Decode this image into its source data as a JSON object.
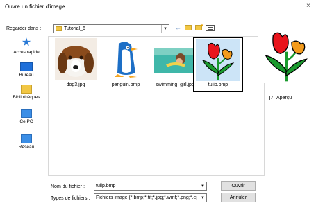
{
  "window": {
    "title": "Ouvre un fichier d'image",
    "close": "×"
  },
  "look_in": {
    "label": "Regarder dans :",
    "value": "Tutorial_6"
  },
  "sidebar": {
    "items": [
      {
        "label": "Accès rapide",
        "icon": "star-icon"
      },
      {
        "label": "Bureau",
        "icon": "desktop-icon"
      },
      {
        "label": "Bibliothèques",
        "icon": "folder-icon"
      },
      {
        "label": "Ce PC",
        "icon": "computer-icon"
      },
      {
        "label": "Réseau",
        "icon": "network-icon"
      }
    ]
  },
  "files": [
    {
      "name": "dog3.jpg",
      "selected": false
    },
    {
      "name": "penguin.bmp",
      "selected": false
    },
    {
      "name": "swimming_girl.jpg",
      "selected": false
    },
    {
      "name": "tulip.bmp",
      "selected": true
    }
  ],
  "filename": {
    "label": "Nom du fichier :",
    "value": "tulip.bmp"
  },
  "filetype": {
    "label": "Types de fichiers :",
    "value": "Fichiers image (*.bmp;*.tif;*.jpg;*.wmf;*.png;*.ep"
  },
  "buttons": {
    "open": "Ouvrir",
    "cancel": "Annuler"
  },
  "preview": {
    "label": "Aperçu",
    "checked": true,
    "checkmark": "✓"
  },
  "colors": {
    "selection_border": "#000000",
    "tulip_red": "#e8141c",
    "tulip_orange": "#f39b1c",
    "tulip_green": "#1a9a2e",
    "accent_blue": "#1e6fd9"
  }
}
